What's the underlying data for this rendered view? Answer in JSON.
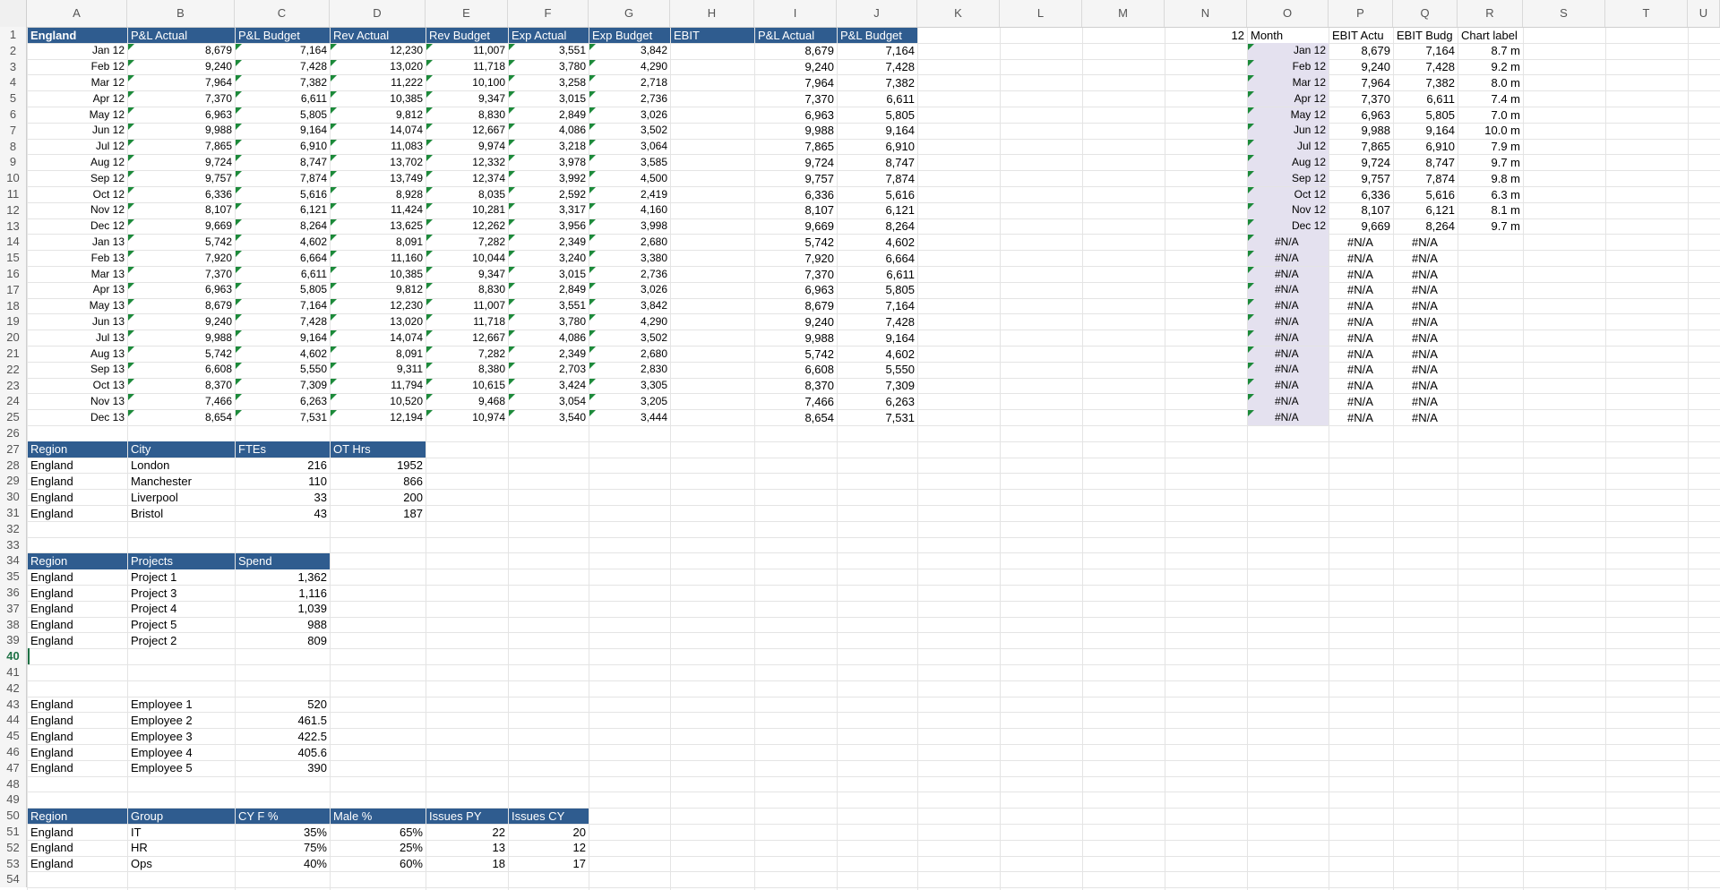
{
  "columns": [
    "A",
    "B",
    "C",
    "D",
    "E",
    "F",
    "G",
    "H",
    "I",
    "J",
    "K",
    "L",
    "M",
    "N",
    "O",
    "P",
    "Q",
    "R",
    "S",
    "T",
    "U"
  ],
  "active_row": 40,
  "colors": {
    "header_fill": "#2f5c8f",
    "header_text": "#ffffff",
    "month_shade": "#e4e1ef",
    "error_triangle": "#1c8a3a",
    "active_row": "#1e7145"
  },
  "main_headers": [
    "England",
    "P&L Actual",
    "P&L Budget",
    "Rev Actual",
    "Rev Budget",
    "Exp Actual",
    "Exp Budget",
    "EBIT",
    "P&L Actual",
    "P&L Budget"
  ],
  "main_rows": [
    [
      "Jan 12",
      "8,679",
      "7,164",
      "12,230",
      "11,007",
      "3,551",
      "3,842",
      "",
      "8,679",
      "7,164"
    ],
    [
      "Feb 12",
      "9,240",
      "7,428",
      "13,020",
      "11,718",
      "3,780",
      "4,290",
      "",
      "9,240",
      "7,428"
    ],
    [
      "Mar 12",
      "7,964",
      "7,382",
      "11,222",
      "10,100",
      "3,258",
      "2,718",
      "",
      "7,964",
      "7,382"
    ],
    [
      "Apr 12",
      "7,370",
      "6,611",
      "10,385",
      "9,347",
      "3,015",
      "2,736",
      "",
      "7,370",
      "6,611"
    ],
    [
      "May 12",
      "6,963",
      "5,805",
      "9,812",
      "8,830",
      "2,849",
      "3,026",
      "",
      "6,963",
      "5,805"
    ],
    [
      "Jun 12",
      "9,988",
      "9,164",
      "14,074",
      "12,667",
      "4,086",
      "3,502",
      "",
      "9,988",
      "9,164"
    ],
    [
      "Jul 12",
      "7,865",
      "6,910",
      "11,083",
      "9,974",
      "3,218",
      "3,064",
      "",
      "7,865",
      "6,910"
    ],
    [
      "Aug 12",
      "9,724",
      "8,747",
      "13,702",
      "12,332",
      "3,978",
      "3,585",
      "",
      "9,724",
      "8,747"
    ],
    [
      "Sep 12",
      "9,757",
      "7,874",
      "13,749",
      "12,374",
      "3,992",
      "4,500",
      "",
      "9,757",
      "7,874"
    ],
    [
      "Oct 12",
      "6,336",
      "5,616",
      "8,928",
      "8,035",
      "2,592",
      "2,419",
      "",
      "6,336",
      "5,616"
    ],
    [
      "Nov 12",
      "8,107",
      "6,121",
      "11,424",
      "10,281",
      "3,317",
      "4,160",
      "",
      "8,107",
      "6,121"
    ],
    [
      "Dec 12",
      "9,669",
      "8,264",
      "13,625",
      "12,262",
      "3,956",
      "3,998",
      "",
      "9,669",
      "8,264"
    ],
    [
      "Jan 13",
      "5,742",
      "4,602",
      "8,091",
      "7,282",
      "2,349",
      "2,680",
      "",
      "5,742",
      "4,602"
    ],
    [
      "Feb 13",
      "7,920",
      "6,664",
      "11,160",
      "10,044",
      "3,240",
      "3,380",
      "",
      "7,920",
      "6,664"
    ],
    [
      "Mar 13",
      "7,370",
      "6,611",
      "10,385",
      "9,347",
      "3,015",
      "2,736",
      "",
      "7,370",
      "6,611"
    ],
    [
      "Apr 13",
      "6,963",
      "5,805",
      "9,812",
      "8,830",
      "2,849",
      "3,026",
      "",
      "6,963",
      "5,805"
    ],
    [
      "May 13",
      "8,679",
      "7,164",
      "12,230",
      "11,007",
      "3,551",
      "3,842",
      "",
      "8,679",
      "7,164"
    ],
    [
      "Jun 13",
      "9,240",
      "7,428",
      "13,020",
      "11,718",
      "3,780",
      "4,290",
      "",
      "9,240",
      "7,428"
    ],
    [
      "Jul 13",
      "9,988",
      "9,164",
      "14,074",
      "12,667",
      "4,086",
      "3,502",
      "",
      "9,988",
      "9,164"
    ],
    [
      "Aug 13",
      "5,742",
      "4,602",
      "8,091",
      "7,282",
      "2,349",
      "2,680",
      "",
      "5,742",
      "4,602"
    ],
    [
      "Sep 13",
      "6,608",
      "5,550",
      "9,311",
      "8,380",
      "2,703",
      "2,830",
      "",
      "6,608",
      "5,550"
    ],
    [
      "Oct 13",
      "8,370",
      "7,309",
      "11,794",
      "10,615",
      "3,424",
      "3,305",
      "",
      "8,370",
      "7,309"
    ],
    [
      "Nov 13",
      "7,466",
      "6,263",
      "10,520",
      "9,468",
      "3,054",
      "3,205",
      "",
      "7,466",
      "6,263"
    ],
    [
      "Dec 13",
      "8,654",
      "7,531",
      "12,194",
      "10,974",
      "3,540",
      "3,444",
      "",
      "8,654",
      "7,531"
    ]
  ],
  "side_top": {
    "n_value": "12",
    "headers": [
      "Month",
      "EBIT Actu",
      "EBIT Budg",
      "Chart label"
    ]
  },
  "side_rows": [
    [
      "Jan 12",
      "8,679",
      "7,164",
      "8.7 m"
    ],
    [
      "Feb 12",
      "9,240",
      "7,428",
      "9.2 m"
    ],
    [
      "Mar 12",
      "7,964",
      "7,382",
      "8.0 m"
    ],
    [
      "Apr 12",
      "7,370",
      "6,611",
      "7.4 m"
    ],
    [
      "May 12",
      "6,963",
      "5,805",
      "7.0 m"
    ],
    [
      "Jun 12",
      "9,988",
      "9,164",
      "10.0 m"
    ],
    [
      "Jul 12",
      "7,865",
      "6,910",
      "7.9 m"
    ],
    [
      "Aug 12",
      "9,724",
      "8,747",
      "9.7 m"
    ],
    [
      "Sep 12",
      "9,757",
      "7,874",
      "9.8 m"
    ],
    [
      "Oct 12",
      "6,336",
      "5,616",
      "6.3 m"
    ],
    [
      "Nov 12",
      "8,107",
      "6,121",
      "8.1 m"
    ],
    [
      "Dec 12",
      "9,669",
      "8,264",
      "9.7 m"
    ],
    [
      "#N/A",
      "#N/A",
      "#N/A",
      ""
    ],
    [
      "#N/A",
      "#N/A",
      "#N/A",
      ""
    ],
    [
      "#N/A",
      "#N/A",
      "#N/A",
      ""
    ],
    [
      "#N/A",
      "#N/A",
      "#N/A",
      ""
    ],
    [
      "#N/A",
      "#N/A",
      "#N/A",
      ""
    ],
    [
      "#N/A",
      "#N/A",
      "#N/A",
      ""
    ],
    [
      "#N/A",
      "#N/A",
      "#N/A",
      ""
    ],
    [
      "#N/A",
      "#N/A",
      "#N/A",
      ""
    ],
    [
      "#N/A",
      "#N/A",
      "#N/A",
      ""
    ],
    [
      "#N/A",
      "#N/A",
      "#N/A",
      ""
    ],
    [
      "#N/A",
      "#N/A",
      "#N/A",
      ""
    ],
    [
      "#N/A",
      "#N/A",
      "#N/A",
      ""
    ]
  ],
  "cities_table": {
    "headers": [
      "Region",
      "City",
      "FTEs",
      "OT Hrs"
    ],
    "rows": [
      [
        "England",
        "London",
        "216",
        "1952"
      ],
      [
        "England",
        "Manchester",
        "110",
        "866"
      ],
      [
        "England",
        "Liverpool",
        "33",
        "200"
      ],
      [
        "England",
        "Bristol",
        "43",
        "187"
      ]
    ]
  },
  "projects_table": {
    "headers": [
      "Region",
      "Projects",
      "Spend"
    ],
    "rows": [
      [
        "England",
        "Project 1",
        "1,362"
      ],
      [
        "England",
        "Project 3",
        "1,116"
      ],
      [
        "England",
        "Project 4",
        "1,039"
      ],
      [
        "England",
        "Project 5",
        "988"
      ],
      [
        "England",
        "Project 2",
        "809"
      ]
    ]
  },
  "employees_table": {
    "rows": [
      [
        "England",
        "Employee 1",
        "520"
      ],
      [
        "England",
        "Employee 2",
        "461.5"
      ],
      [
        "England",
        "Employee 3",
        "422.5"
      ],
      [
        "England",
        "Employee 4",
        "405.6"
      ],
      [
        "England",
        "Employee 5",
        "390"
      ]
    ]
  },
  "groups_table": {
    "headers": [
      "Region",
      "Group",
      "CY F %",
      "Male %",
      "Issues PY",
      "Issues CY"
    ],
    "rows": [
      [
        "England",
        "IT",
        "35%",
        "65%",
        "22",
        "20"
      ],
      [
        "England",
        "HR",
        "75%",
        "25%",
        "13",
        "12"
      ],
      [
        "England",
        "Ops",
        "40%",
        "60%",
        "18",
        "17"
      ]
    ]
  }
}
